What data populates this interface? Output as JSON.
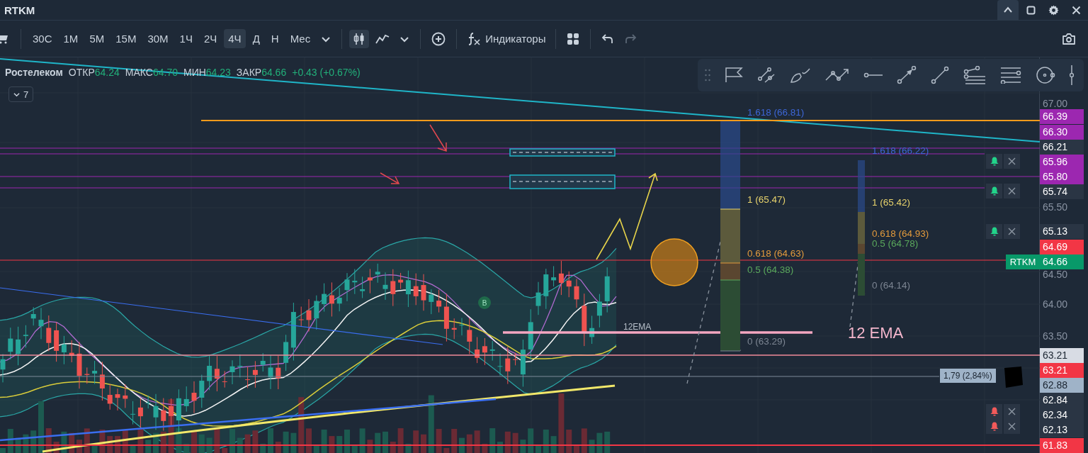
{
  "window": {
    "title": "RTKM"
  },
  "toolbar": {
    "intervals": [
      {
        "label": "30С",
        "selected": false
      },
      {
        "label": "1М",
        "selected": false
      },
      {
        "label": "5М",
        "selected": false
      },
      {
        "label": "15М",
        "selected": false
      },
      {
        "label": "30М",
        "selected": false
      },
      {
        "label": "1Ч",
        "selected": false
      },
      {
        "label": "2Ч",
        "selected": false
      },
      {
        "label": "4Ч",
        "selected": true
      },
      {
        "label": "Д",
        "selected": false
      },
      {
        "label": "Н",
        "selected": false
      },
      {
        "label": "Мес",
        "selected": false
      }
    ],
    "chart_types": [
      {
        "kind": "candles",
        "selected": true
      },
      {
        "kind": "line",
        "selected": false
      }
    ],
    "indicators_label": "Индикаторы",
    "history": [
      {
        "kind": "undo",
        "disabled": false
      },
      {
        "kind": "redo",
        "disabled": true
      }
    ]
  },
  "legend": {
    "name": "Ростелеком",
    "fields": [
      {
        "label": "ОТКР",
        "value": "64.24"
      },
      {
        "label": "МАКС",
        "value": "64.70"
      },
      {
        "label": "МИН",
        "value": "64.23"
      },
      {
        "label": "ЗАКР",
        "value": "64.66"
      }
    ],
    "change": "+0.43 (+0.67%)",
    "collapsed_count": "7"
  },
  "fib_left": [
    {
      "label": "1.618 (66.81)",
      "color": "#3d66d6"
    },
    {
      "label": "1 (65.47)",
      "color": "#e8d36c"
    },
    {
      "label": "0.618 (64.63)",
      "color": "#e29a3c"
    },
    {
      "label": "0.5 (64.38)",
      "color": "#5aa85c"
    },
    {
      "label": "0 (63.29)",
      "color": "#7c8592"
    }
  ],
  "fib_right": [
    {
      "label": "1.618 (66.22)",
      "color": "#3d66d6"
    },
    {
      "label": "1 (65.42)",
      "color": "#e8d36c"
    },
    {
      "label": "0.618 (64.93)",
      "color": "#e29a3c"
    },
    {
      "label": "0.5 (64.78)",
      "color": "#5aa85c"
    },
    {
      "label": "0 (64.14)",
      "color": "#7c8592"
    }
  ],
  "annotations": {
    "ema_small": "12EMA",
    "ema_large": "12 EMA",
    "marker": "B",
    "measure": "1,79 (2,84%)"
  },
  "alerts": [
    {
      "color": "#22d38a"
    },
    {
      "color": "#22d38a"
    },
    {
      "color": "#22d38a"
    },
    {
      "color": "#f25a5a"
    },
    {
      "color": "#f25a5a"
    }
  ],
  "price_axis": [
    {
      "text": "67.00",
      "kind": "tick"
    },
    {
      "text": "66.39",
      "kind": "badge",
      "color": "#9c27b0"
    },
    {
      "text": "66.30",
      "kind": "badge",
      "color": "#9c27b0"
    },
    {
      "text": "66.21",
      "kind": "badge",
      "color": "#2a3544"
    },
    {
      "text": "65.96",
      "kind": "badge",
      "color": "#9c27b0"
    },
    {
      "text": "65.80",
      "kind": "badge",
      "color": "#9c27b0"
    },
    {
      "text": "65.74",
      "kind": "badge",
      "color": "#2a3544"
    },
    {
      "text": "65.50",
      "kind": "tick"
    },
    {
      "text": "65.13",
      "kind": "badge",
      "color": "#2a3544"
    },
    {
      "text": "64.69",
      "kind": "badge",
      "color": "#f23645"
    },
    {
      "text": "64.66",
      "kind": "badge",
      "color": "#089969",
      "tag": "RTKM"
    },
    {
      "text": "64.50",
      "kind": "tick"
    },
    {
      "text": "64.00",
      "kind": "tick"
    },
    {
      "text": "63.50",
      "kind": "tick"
    },
    {
      "text": "63.21",
      "kind": "badge_light",
      "color": "#d8dce4"
    },
    {
      "text": "63.21",
      "kind": "badge",
      "color": "#f23645"
    },
    {
      "text": "62.88",
      "kind": "badge_light",
      "color": "#9fb3c8"
    },
    {
      "text": "62.84",
      "kind": "badge",
      "color": "#2a3544"
    },
    {
      "text": "62.34",
      "kind": "badge",
      "color": "#2a3544"
    },
    {
      "text": "62.13",
      "kind": "badge",
      "color": "#2a3544"
    },
    {
      "text": "61.83",
      "kind": "badge",
      "color": "#f23645"
    }
  ]
}
